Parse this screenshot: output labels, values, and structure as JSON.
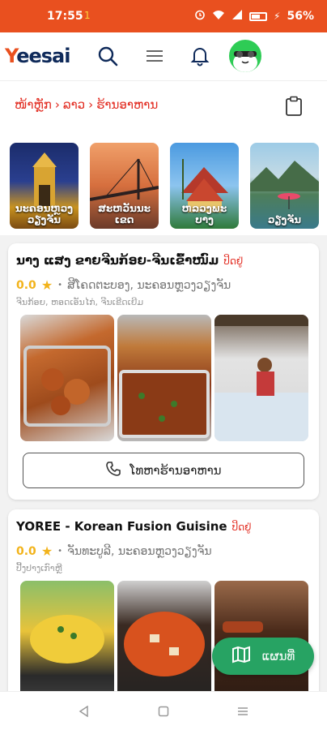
{
  "status_bar": {
    "time": "17:55",
    "dot": "1",
    "battery": "56%"
  },
  "app": {
    "logo_first": "Y",
    "logo_rest": "eesai"
  },
  "breadcrumb": {
    "home": "ໜ້າຫຼັກ",
    "sep1": "›",
    "country": "ລາວ",
    "sep2": "›",
    "current": "ຮ້ານອາຫານ"
  },
  "categories": [
    {
      "label": "ນະຄອນຫຼວງ ວຽງຈັນ"
    },
    {
      "label": "ສະຫວັນນະເຂດ"
    },
    {
      "label": "ຫລວງພະບາງ"
    },
    {
      "label": "ວຽງຈັນ"
    }
  ],
  "restaurants": [
    {
      "name": "ນາງ ແສງ ຂາຍຈີນກ້ອຍ-ຈີນເຂົ້າໜົມ",
      "status": "ປິດຢູ່",
      "rating": "0.0",
      "location": "ສີໂຄດຕະບອງ, ນະຄອນຫຼວງວຽງຈັນ",
      "tags": "ຈີນກ້ອຍ, ຫອດເອັນໄກ່, ຈີນເຂີດເຍີມ",
      "call_label": "ໂທຫາຮ້ານອາຫານ"
    },
    {
      "name": "YOREE - Korean Fusion Guisine",
      "status": "ປິດຢູ່",
      "rating": "0.0",
      "location": "ຈັນທະບູລີ, ນະຄອນຫຼວງວຽງຈັນ",
      "tags": "ປີ້ງປາງເກົາຫຼີ"
    }
  ],
  "map_button": {
    "label": "ແຜນທີ່"
  },
  "colors": {
    "brand": "#e9501f",
    "accent_red": "#e22b20",
    "map_green": "#27a363",
    "star": "#f2b31b"
  }
}
